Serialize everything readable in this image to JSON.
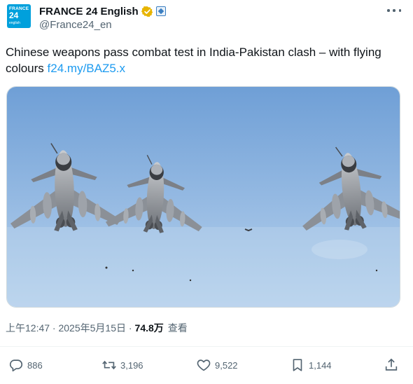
{
  "account": {
    "display_name": "FRANCE 24 English",
    "handle": "@France24_en",
    "avatar_logo": {
      "line1": "FRANCE",
      "line2": "24",
      "line3": "english"
    }
  },
  "tweet": {
    "text": "Chinese weapons pass combat test in India-Pakistan clash – with flying colours",
    "link": "f24.my/BAZ5.x"
  },
  "meta": {
    "timestamp": "上午12:47 · 2025年5月15日 ·",
    "views_count": "74.8万",
    "views_label": "查看"
  },
  "actions": {
    "reply_count": "886",
    "repost_count": "3,196",
    "like_count": "9,522",
    "bookmark_count": "1,144"
  },
  "colors": {
    "accent": "#1d9bf0",
    "text_secondary": "#536471",
    "verified_badge": "#e7b400",
    "sky_top": "#6f9fd6",
    "sky_bottom": "#b6d2ee"
  },
  "icons": [
    "verified-badge-icon",
    "affiliation-icon",
    "more-icon",
    "reply-icon",
    "repost-icon",
    "like-icon",
    "bookmark-icon",
    "share-icon"
  ]
}
